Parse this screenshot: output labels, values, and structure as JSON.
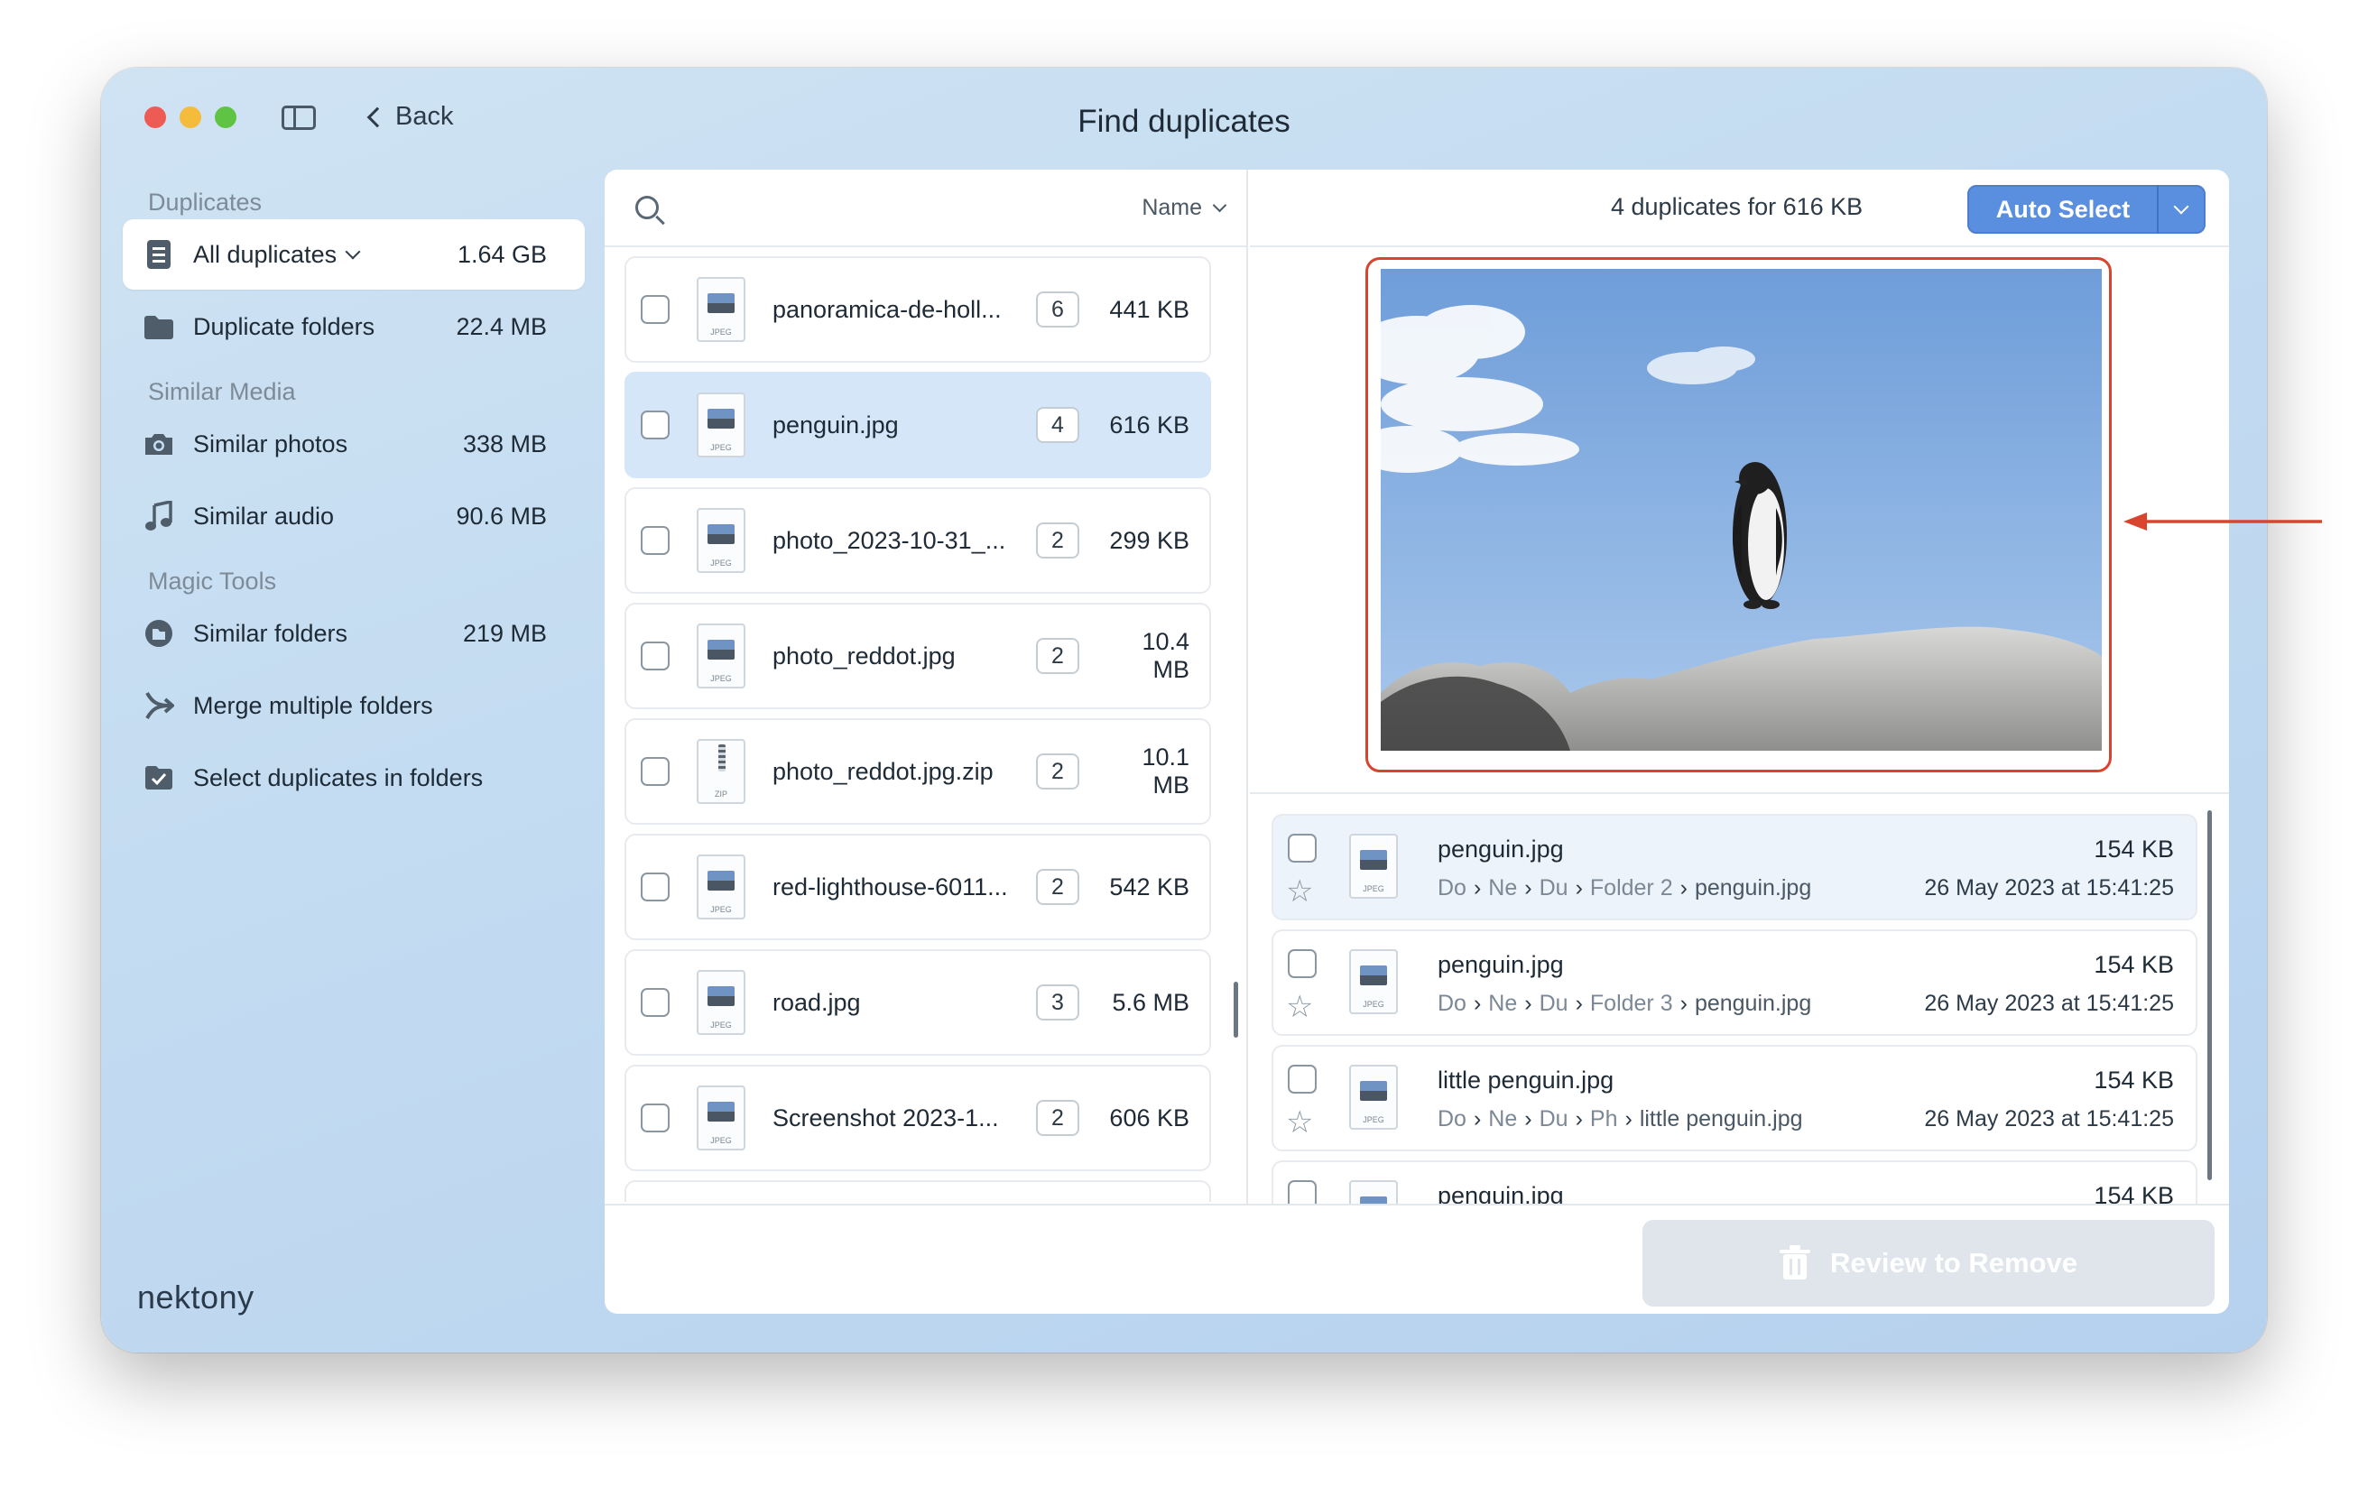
{
  "window": {
    "title": "Find duplicates",
    "back_label": "Back"
  },
  "sidebar": {
    "sections": [
      {
        "title": "Duplicates",
        "items": [
          {
            "label": "All duplicates",
            "size": "1.64 GB",
            "icon": "document-list-icon",
            "active": true,
            "has_dropdown": true
          },
          {
            "label": "Duplicate folders",
            "size": "22.4 MB",
            "icon": "folder-icon"
          }
        ]
      },
      {
        "title": "Similar Media",
        "items": [
          {
            "label": "Similar photos",
            "size": "338 MB",
            "icon": "camera-icon"
          },
          {
            "label": "Similar audio",
            "size": "90.6 MB",
            "icon": "music-note-icon"
          }
        ]
      },
      {
        "title": "Magic Tools",
        "items": [
          {
            "label": "Similar folders",
            "size": "219 MB",
            "icon": "similar-folders-icon"
          },
          {
            "label": "Merge multiple folders",
            "size": "",
            "icon": "merge-icon"
          },
          {
            "label": "Select duplicates in folders",
            "size": "",
            "icon": "checkbox-folder-icon"
          }
        ]
      }
    ],
    "brand": "nektony"
  },
  "file_list": {
    "sort_label": "Name",
    "rows": [
      {
        "name": "panoramica-de-holl...",
        "count": "6",
        "size": "441 KB",
        "type": "JPEG",
        "selected": false
      },
      {
        "name": "penguin.jpg",
        "count": "4",
        "size": "616 KB",
        "type": "JPEG",
        "selected": true
      },
      {
        "name": "photo_2023-10-31_...",
        "count": "2",
        "size": "299 KB",
        "type": "JPEG",
        "selected": false
      },
      {
        "name": "photo_reddot.jpg",
        "count": "2",
        "size": "10.4 MB",
        "type": "JPEG",
        "selected": false
      },
      {
        "name": "photo_reddot.jpg.zip",
        "count": "2",
        "size": "10.1 MB",
        "type": "ZIP",
        "selected": false
      },
      {
        "name": "red-lighthouse-6011...",
        "count": "2",
        "size": "542 KB",
        "type": "JPEG",
        "selected": false
      },
      {
        "name": "road.jpg",
        "count": "3",
        "size": "5.6 MB",
        "type": "JPEG",
        "selected": false
      },
      {
        "name": "Screenshot 2023-1...",
        "count": "2",
        "size": "606 KB",
        "type": "JPEG",
        "selected": false
      }
    ]
  },
  "detail": {
    "summary": "4 duplicates for 616 KB",
    "auto_select_label": "Auto Select",
    "duplicates": [
      {
        "name": "penguin.jpg",
        "size": "154 KB",
        "path": [
          "Do",
          "Ne",
          "Du",
          "Folder 2",
          "penguin.jpg"
        ],
        "date": "26 May 2023 at 15:41:25",
        "highlighted": true
      },
      {
        "name": "penguin.jpg",
        "size": "154 KB",
        "path": [
          "Do",
          "Ne",
          "Du",
          "Folder 3",
          "penguin.jpg"
        ],
        "date": "26 May 2023 at 15:41:25",
        "highlighted": false
      },
      {
        "name": "little penguin.jpg",
        "size": "154 KB",
        "path": [
          "Do",
          "Ne",
          "Du",
          "Ph",
          "little penguin.jpg"
        ],
        "date": "26 May 2023 at 15:41:25",
        "highlighted": false
      },
      {
        "name": "penguin.jpg",
        "size": "154 KB",
        "path": [],
        "date": "",
        "highlighted": false
      }
    ]
  },
  "footer": {
    "review_label": "Review to Remove"
  },
  "colors": {
    "accent": "#5a8fdf",
    "highlight_frame": "#d9442f",
    "selected_row": "#d6e6f9"
  }
}
